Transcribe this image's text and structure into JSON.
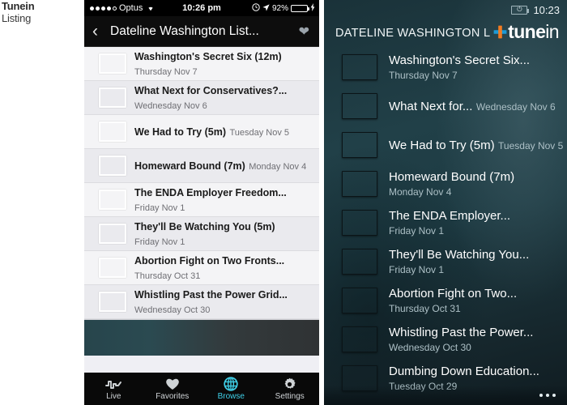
{
  "caption": {
    "title": "Tunein",
    "subtitle": "Listing"
  },
  "ios": {
    "status": {
      "carrier": "Optus",
      "signal_dots_filled": 4,
      "signal_dots_total": 5,
      "wifi_icon": "wifi-icon",
      "time": "10:26 pm",
      "alarm_icon": "alarm-clock-icon",
      "location_icon": "location-arrow-icon",
      "battery_percent": "92%",
      "battery_level": 92,
      "charging_icon": "lightning-bolt-icon",
      "battery_color": "#4cd964"
    },
    "nav": {
      "back_icon": "chevron-left-icon",
      "title": "Dateline Washington List...",
      "favorite_icon": "heart-icon"
    },
    "list": [
      {
        "title": "Washington's Secret Six (12m)",
        "date": "Thursday Nov 7"
      },
      {
        "title": "What Next for Conservatives?...",
        "date": "Wednesday Nov 6"
      },
      {
        "title": "We Had to Try (5m)",
        "date": "Tuesday Nov 5"
      },
      {
        "title": "Homeward Bound (7m)",
        "date": "Monday Nov 4"
      },
      {
        "title": "The ENDA Employer Freedom...",
        "date": "Friday Nov 1"
      },
      {
        "title": "They'll Be Watching You (5m)",
        "date": "Friday Nov 1"
      },
      {
        "title": "Abortion Fight on Two Fronts...",
        "date": "Thursday Oct 31"
      },
      {
        "title": "Whistling Past the Power Grid...",
        "date": "Wednesday Oct 30"
      }
    ],
    "tabs": [
      {
        "label": "Live",
        "icon": "waveform-icon",
        "active": false
      },
      {
        "label": "Favorites",
        "icon": "heart-icon",
        "active": false
      },
      {
        "label": "Browse",
        "icon": "globe-icon",
        "active": true
      },
      {
        "label": "Settings",
        "icon": "gear-icon",
        "active": false
      }
    ],
    "active_tab_color": "#3fd0e8"
  },
  "wp": {
    "status": {
      "battery_icon": "battery-charging-icon",
      "time": "10:23"
    },
    "header": {
      "title": "DATELINE WASHINGTON LISTI",
      "logo_mark": "tunein-plus-icon",
      "logo_bold": "tune",
      "logo_light": "in",
      "logo_orange": "#f47b20",
      "logo_blue": "#1c9ad6"
    },
    "list": [
      {
        "title": "Washington's Secret Six...",
        "date": "Thursday Nov 7"
      },
      {
        "title": "What Next for...",
        "date": "Wednesday Nov 6"
      },
      {
        "title": "We Had to Try (5m)",
        "date": "Tuesday Nov 5"
      },
      {
        "title": "Homeward Bound (7m)",
        "date": "Monday Nov 4"
      },
      {
        "title": "The ENDA Employer...",
        "date": "Friday Nov 1"
      },
      {
        "title": "They'll Be Watching You...",
        "date": "Friday Nov 1"
      },
      {
        "title": "Abortion Fight on Two...",
        "date": "Thursday Oct 31"
      },
      {
        "title": "Whistling Past the Power...",
        "date": "Wednesday Oct 30"
      },
      {
        "title": "Dumbing Down Education...",
        "date": "Tuesday Oct 29"
      }
    ],
    "appbar": {
      "more_icon": "ellipsis-icon"
    }
  }
}
